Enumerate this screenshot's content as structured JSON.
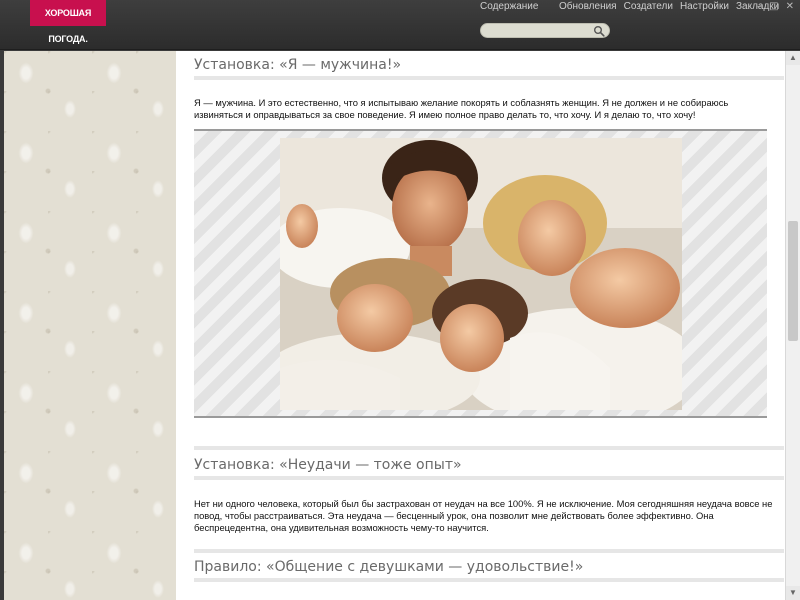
{
  "header": {
    "logo_text": "ХОРОШАЯ ПОГОДА.",
    "nav_contents": "Содержание",
    "nav_items": [
      "Обновления",
      "Создатели",
      "Настройки",
      "Закладки"
    ],
    "search_placeholder": "",
    "colors": {
      "logo_bg": "#c8104e",
      "bar_bg": "#333333"
    }
  },
  "window_controls": {
    "minimize": "–",
    "maximize": "□",
    "close": "✕"
  },
  "sections": [
    {
      "title": "Установка: «Я — мужчина!»",
      "text": "Я — мужчина. И это естественно, что я испытываю желание покорять и соблазнять женщин. Я не должен и не собираюсь извиняться и оправдываться за свое поведение. Я имею полное право делать то, что хочу. И я делаю то, что хочу!"
    },
    {
      "title": "Установка: «Неудачи — тоже опыт»",
      "text": "Нет ни одного человека, который был бы застрахован от неудач на все 100%. Я не исключение. Моя сегодняшняя неудача вовсе не повод, чтобы расстраиваться. Эта неудача — бесценный урок, она позволит мне действовать более эффективно. Она беспрецедентна, она удивительная возможность чему-то научится."
    },
    {
      "title": "Правило: «Общение с девушками — удовольствие!»"
    }
  ],
  "icons": {
    "search": "search-icon",
    "scroll_up": "arrow-up-icon",
    "scroll_down": "arrow-down-icon"
  }
}
